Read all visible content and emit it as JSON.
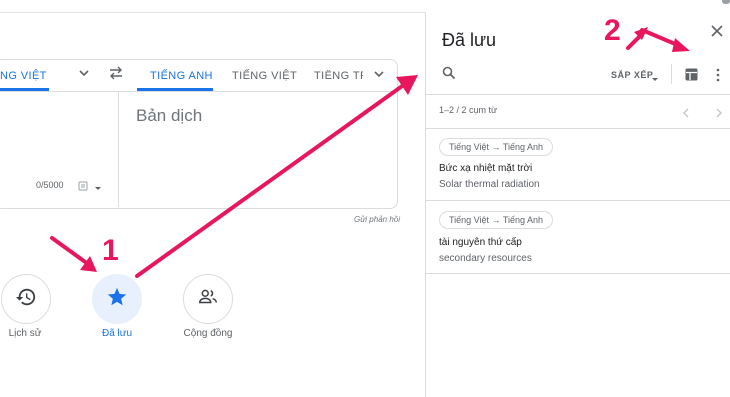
{
  "translator": {
    "source_langs": [
      "NG VIỆT"
    ],
    "target_langs": [
      "TIẾNG ANH",
      "TIẾNG VIỆT",
      "TIẾNG TRU"
    ],
    "output_placeholder": "Bản dịch",
    "char_count": "0/5000",
    "feedback": "Gửi phản hồi"
  },
  "quick_actions": [
    {
      "label": "Lịch sử",
      "icon": "history-icon"
    },
    {
      "label": "Đã lưu",
      "icon": "star-icon",
      "active": true
    },
    {
      "label": "Cộng đồng",
      "icon": "community-icon"
    }
  ],
  "saved_panel": {
    "title": "Đã lưu",
    "sort_label": "SẮP XẾP",
    "range_label": "1–2 / 2 cụm từ",
    "items": [
      {
        "lang_pair": "Tiếng Việt → Tiếng Anh",
        "source": "Bức xạ nhiệt mặt trời",
        "translation": "Solar thermal radiation"
      },
      {
        "lang_pair": "Tiếng Việt → Tiếng Anh",
        "source": "tài nguyên thứ cấp",
        "translation": "secondary resources"
      }
    ]
  },
  "annotations": [
    "1",
    "2"
  ],
  "colors": {
    "accent": "#1a73e8",
    "annotation": "#e8175d",
    "active_bg": "#e8f0fe"
  }
}
